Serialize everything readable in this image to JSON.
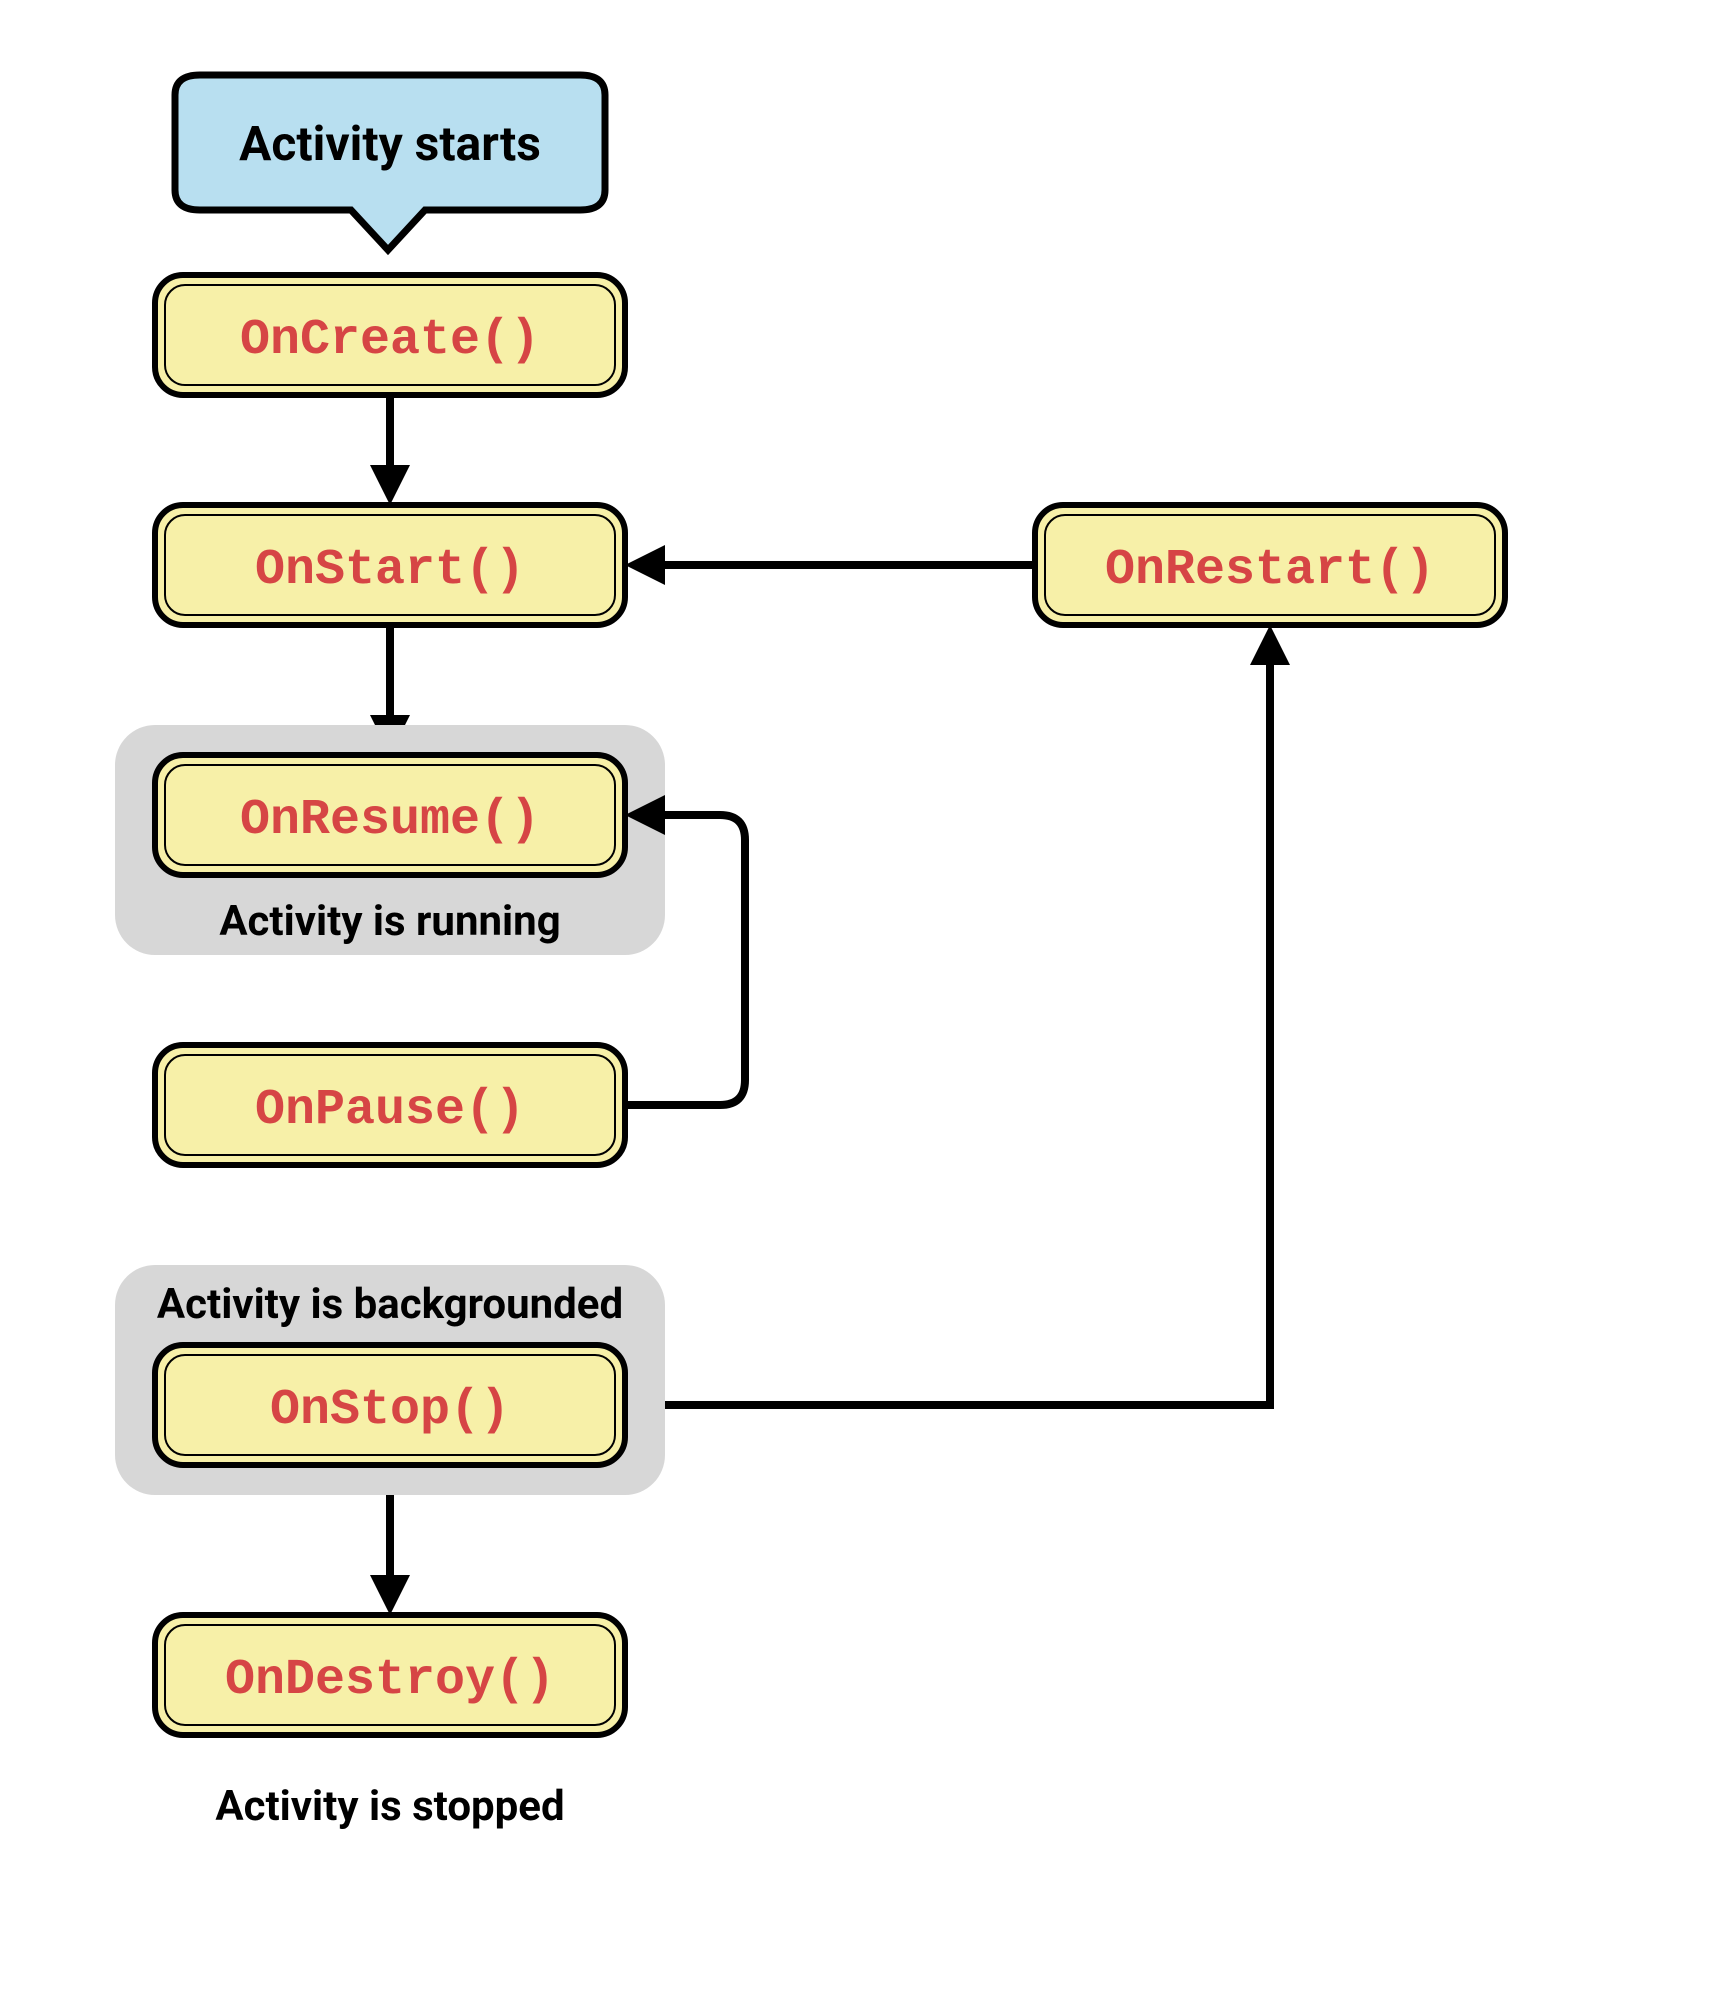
{
  "start_label": "Activity starts",
  "methods": {
    "oncreate": "OnCreate()",
    "onstart": "OnStart()",
    "onrestart": "OnRestart()",
    "onresume": "OnResume()",
    "onpause": "OnPause()",
    "onstop": "OnStop()",
    "ondestroy": "OnDestroy()"
  },
  "labels": {
    "running": "Activity is running",
    "backgrounded": "Activity is backgrounded",
    "stopped": "Activity is stopped"
  }
}
